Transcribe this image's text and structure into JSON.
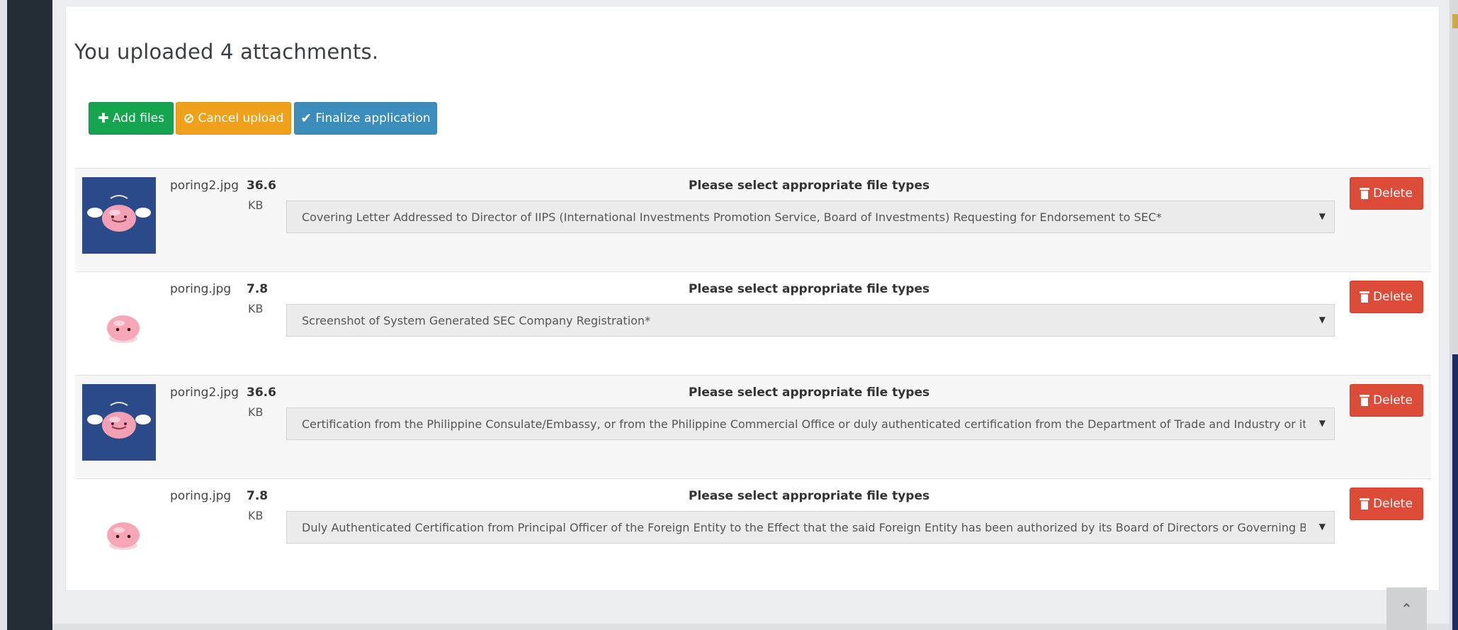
{
  "heading": "You uploaded 4 attachments.",
  "toolbar": {
    "add_files": "Add files",
    "cancel_upload": "Cancel upload",
    "finalize": "Finalize application"
  },
  "files": [
    {
      "name": "poring2.jpg",
      "size": "36.6",
      "unit": "KB",
      "thumbnail": "poring-winged-blue",
      "prompt": "Please select appropriate file types",
      "selected": "Covering Letter Addressed to Director of IIPS (International Investments Promotion Service, Board of Investments) Requesting for Endorsement to SEC*",
      "delete_label": "Delete"
    },
    {
      "name": "poring.jpg",
      "size": "7.8",
      "unit": "KB",
      "thumbnail": "poring-pink-white",
      "prompt": "Please select appropriate file types",
      "selected": "Screenshot of System Generated SEC Company Registration*",
      "delete_label": "Delete"
    },
    {
      "name": "poring2.jpg",
      "size": "36.6",
      "unit": "KB",
      "thumbnail": "poring-winged-blue",
      "prompt": "Please select appropriate file types",
      "selected": "Certification from the Philippine Consulate/Embassy, or from the Philippine Commercial Office or duly authenticated certification from the Department of Trade and Industry or its equivalent",
      "delete_label": "Delete"
    },
    {
      "name": "poring.jpg",
      "size": "7.8",
      "unit": "KB",
      "thumbnail": "poring-pink-white",
      "prompt": "Please select appropriate file types",
      "selected": "Duly Authenticated Certification from Principal Officer of the Foreign Entity to the Effect that the said Foreign Entity has been authorized by its Board of Directors or Governing Body to Establi",
      "delete_label": "Delete"
    }
  ],
  "colors": {
    "add": "#15a44f",
    "cancel": "#f0a11c",
    "finalize": "#3c8dbc",
    "delete": "#dd4b39",
    "sidebar": "#232c33"
  }
}
